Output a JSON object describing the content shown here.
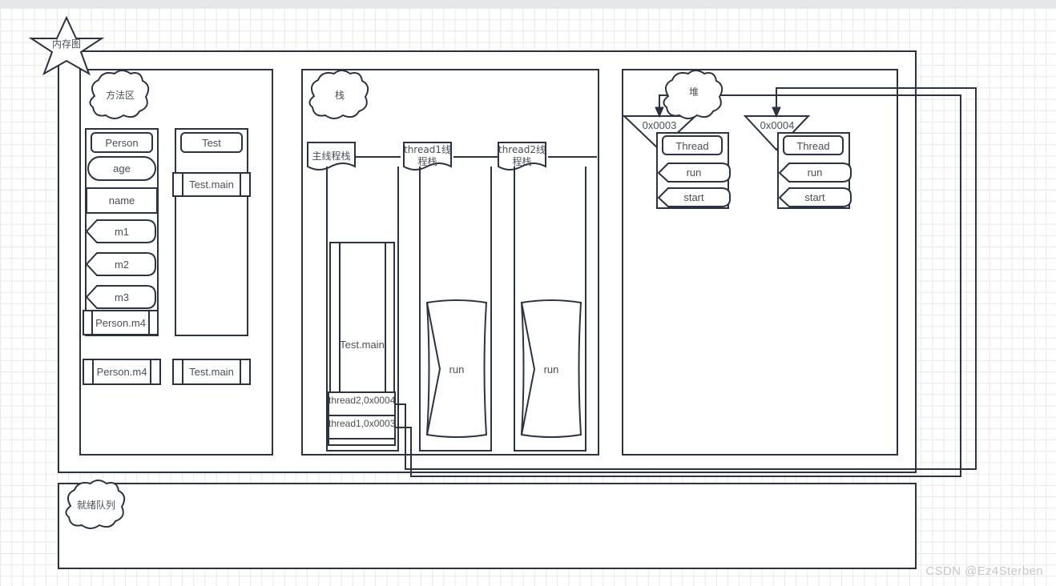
{
  "diagram": {
    "title": "内存图",
    "watermark": "CSDN @Ez4Sterben",
    "stroke_color": "#2b3340",
    "text_color": "#4a4f57",
    "grid_color": "#e8e8e8",
    "background": "#ffffff"
  },
  "regions": {
    "method_area": {
      "cloud_label": "方法区",
      "classes": [
        {
          "name": "Person",
          "members": [
            {
              "label": "age",
              "shape": "stadium"
            },
            {
              "label": "name",
              "shape": "rect"
            },
            {
              "label": "m1",
              "shape": "method"
            },
            {
              "label": "m2",
              "shape": "method"
            },
            {
              "label": "m3",
              "shape": "method"
            }
          ],
          "frame": {
            "label": "Person.m4",
            "shape": "process"
          }
        },
        {
          "name": "Test",
          "members": [],
          "frame": {
            "label": "Test.main",
            "shape": "process"
          }
        }
      ],
      "detached_frames": [
        {
          "label": "Person.m4",
          "shape": "process"
        },
        {
          "label": "Test.main",
          "shape": "process"
        }
      ]
    },
    "stack": {
      "cloud_label": "栈",
      "threads": [
        {
          "label": "主线程栈",
          "frames": [
            {
              "label": "Test.main",
              "shape": "process-tall"
            }
          ],
          "refs": [
            {
              "label": "thread2,0x0004"
            },
            {
              "label": "thread1,0x0003"
            }
          ]
        },
        {
          "label": "thread1线程栈",
          "frames": [
            {
              "label": "run",
              "shape": "data-tall"
            }
          ],
          "refs": []
        },
        {
          "label": "thread2线程栈",
          "frames": [
            {
              "label": "run",
              "shape": "data-tall"
            }
          ],
          "refs": []
        }
      ]
    },
    "heap": {
      "cloud_label": "堆",
      "objects": [
        {
          "address": "0x0003",
          "class": "Thread",
          "methods": [
            "run",
            "start"
          ]
        },
        {
          "address": "0x0004",
          "class": "Thread",
          "methods": [
            "run",
            "start"
          ]
        }
      ]
    },
    "ready_queue": {
      "cloud_label": "就绪队列",
      "items": []
    }
  }
}
